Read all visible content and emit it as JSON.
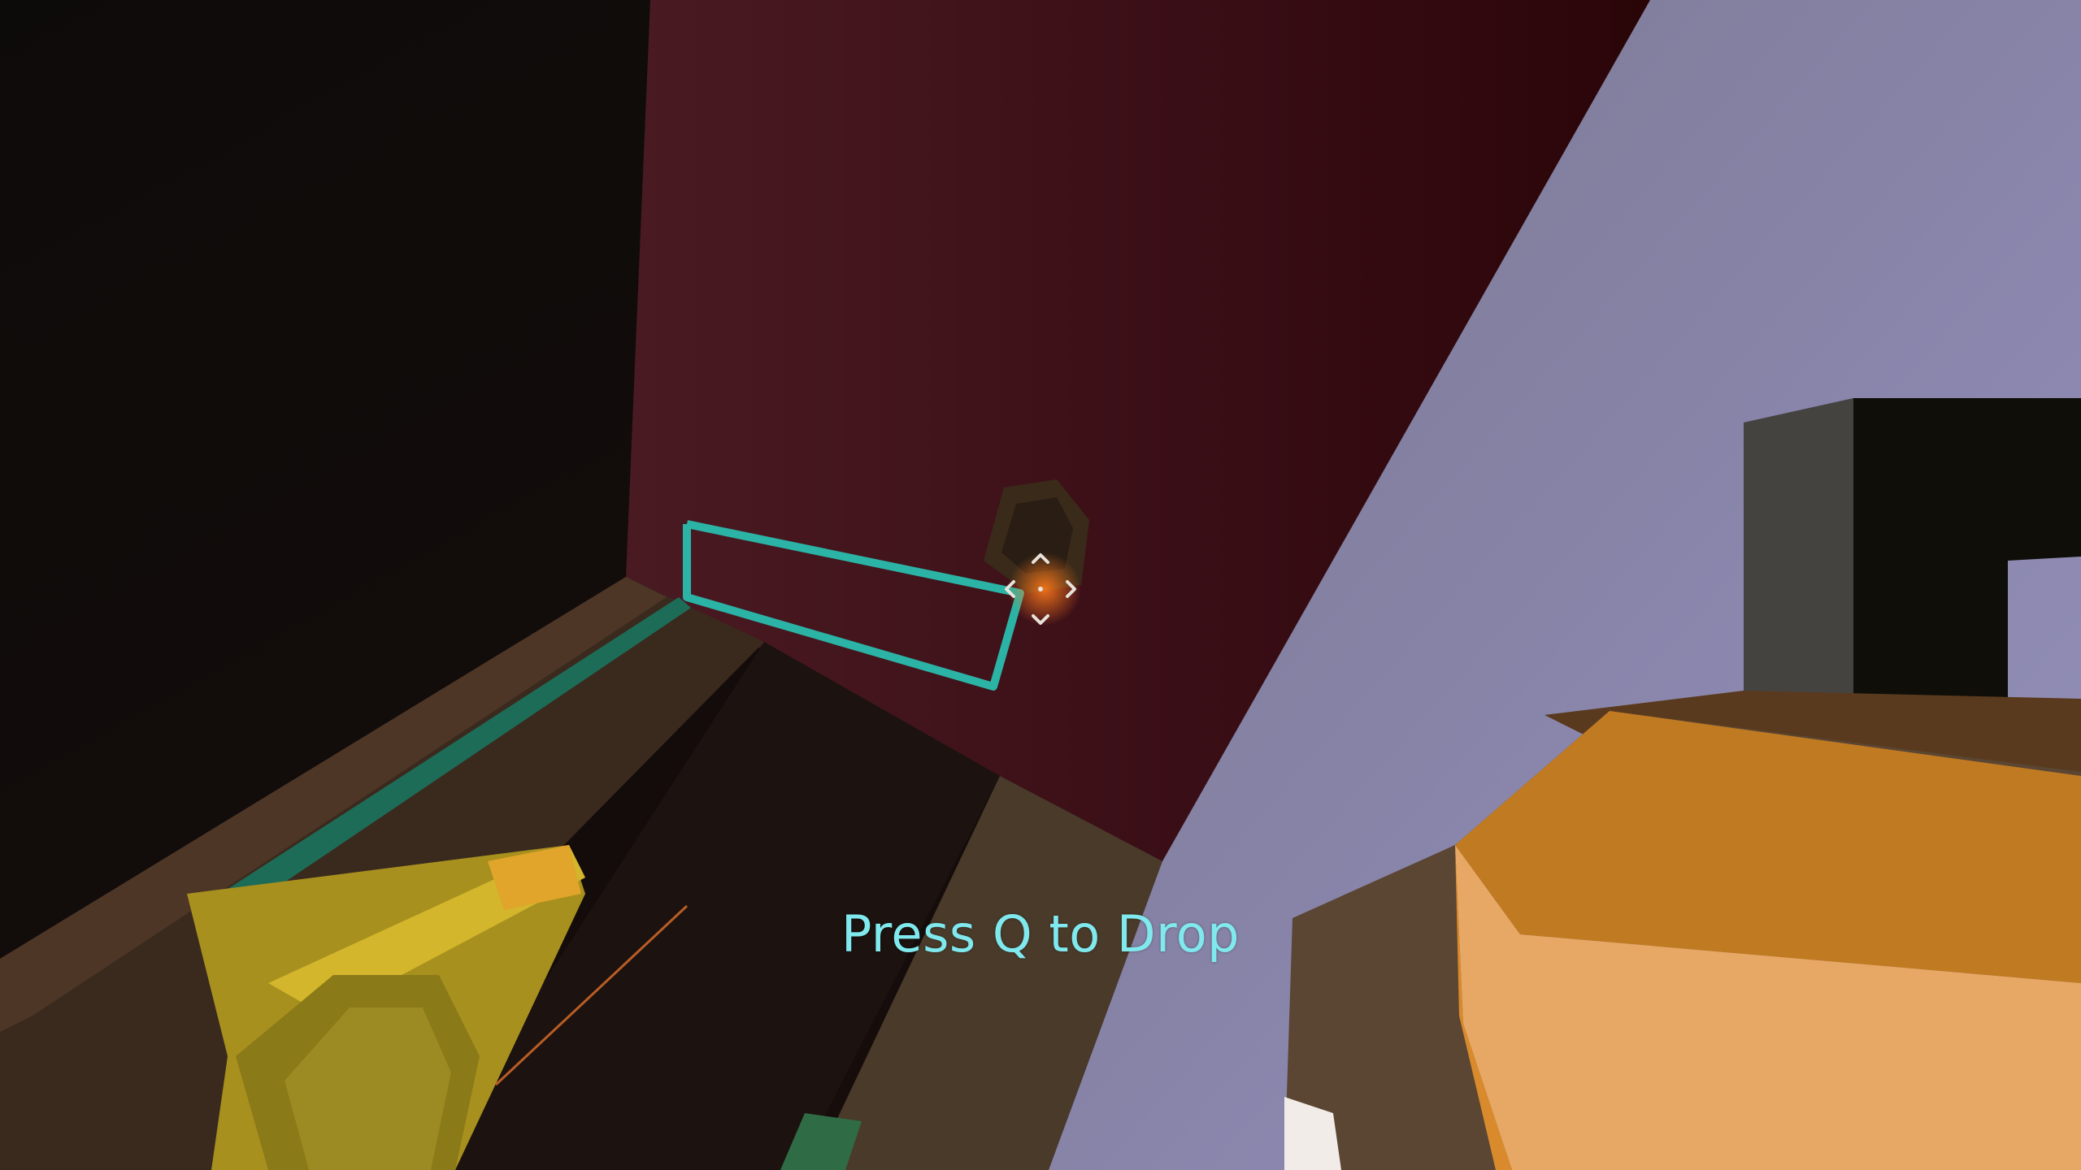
{
  "hud": {
    "prompt_text": "Press Q to Drop",
    "prompt_color": "#7fe9ee",
    "crosshair_icon": "crosshair-arrows-icon",
    "crosshair_color": "#e8e2dc"
  },
  "scene": {
    "outline_color": "#2bb3a5",
    "wall_color": "#3a0f16",
    "held_item_color": "#e39a36"
  }
}
